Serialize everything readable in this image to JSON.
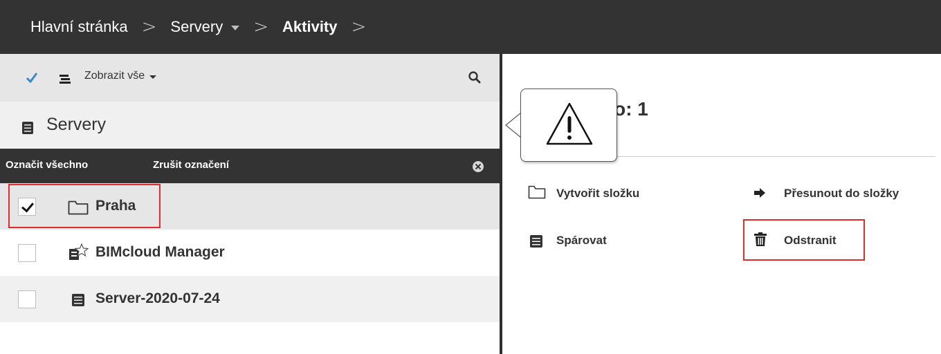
{
  "breadcrumb": {
    "home": "Hlavní stránka",
    "servers": "Servery",
    "current": "Aktivity"
  },
  "toolbar": {
    "show_all": "Zobrazit vše"
  },
  "panel": {
    "title": "Servery"
  },
  "selection": {
    "select_all": "Označit všechno",
    "deselect": "Zrušit označení"
  },
  "list": {
    "items": [
      {
        "label": "Praha",
        "checked": true,
        "icon": "folder-icon"
      },
      {
        "label": "BIMcloud Manager",
        "checked": false,
        "icon": "bimcloud-manager-icon"
      },
      {
        "label": "Server-2020-07-24",
        "checked": false,
        "icon": "server-icon"
      }
    ]
  },
  "details": {
    "heading_visible": "no: 1"
  },
  "actions": {
    "create_folder": "Vytvořit složku",
    "move_to_folder": "Přesunout do složky",
    "pair": "Spárovat",
    "delete": "Odstranit"
  },
  "colors": {
    "topbar": "#333333",
    "highlight": "#e12a2a",
    "check_accent": "#3a88c4"
  }
}
